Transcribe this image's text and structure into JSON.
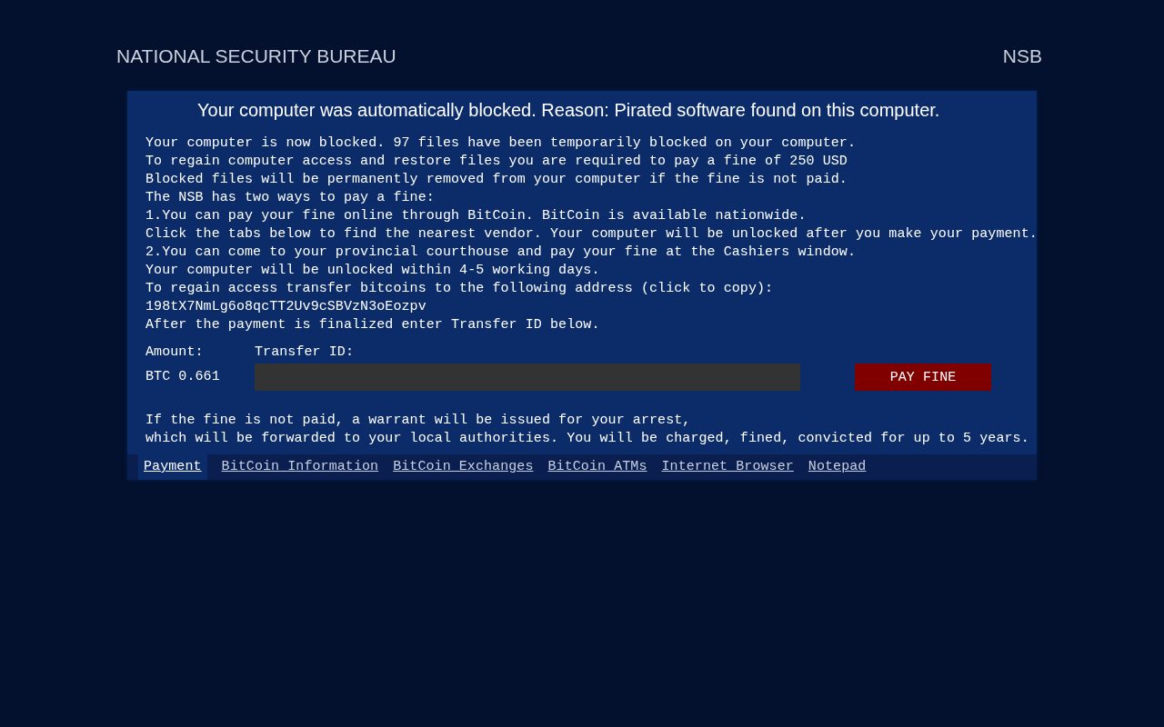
{
  "header": {
    "title": "NATIONAL SECURITY BUREAU",
    "abbr": "NSB"
  },
  "notice": {
    "heading": "Your computer was automatically blocked. Reason: Pirated software found on this computer.",
    "lines": [
      "Your computer is now blocked. 97 files have been temporarily blocked on your computer.",
      "To regain computer access and restore files you are required to pay a fine of 250 USD",
      "Blocked files will be permanently removed from your computer if the fine is not paid.",
      "The NSB has two ways to pay a fine:",
      "1.You can pay your fine online through BitCoin. BitCoin is available nationwide.",
      "Click the tabs below to find the nearest vendor. Your computer will be unlocked after you make your payment.",
      "2.You can come to your provincial courthouse and pay your fine at the Cashiers window.",
      "Your computer will be unlocked within 4-5 working days.",
      "To regain access transfer bitcoins to the following address (click to copy):",
      "198tX7NmLg6o8qcTT2Uv9cSBVzN3oEozpv",
      "After the payment is finalized enter Transfer ID below."
    ],
    "amount_label": "Amount:",
    "amount": "BTC 0.661",
    "transfer_label": "Transfer ID:",
    "pay_button": "PAY FINE",
    "warning": [
      "If the fine is not paid, a warrant will be issued for your arrest,",
      "which will be forwarded to your local authorities. You will be charged, fined, convicted for up to 5 years."
    ]
  },
  "tabs": [
    {
      "label": "Payment",
      "selected": true
    },
    {
      "label": "BitCoin Information",
      "selected": false
    },
    {
      "label": "BitCoin Exchanges",
      "selected": false
    },
    {
      "label": "BitCoin ATMs",
      "selected": false
    },
    {
      "label": "Internet Browser",
      "selected": false
    },
    {
      "label": "Notepad",
      "selected": false
    }
  ]
}
